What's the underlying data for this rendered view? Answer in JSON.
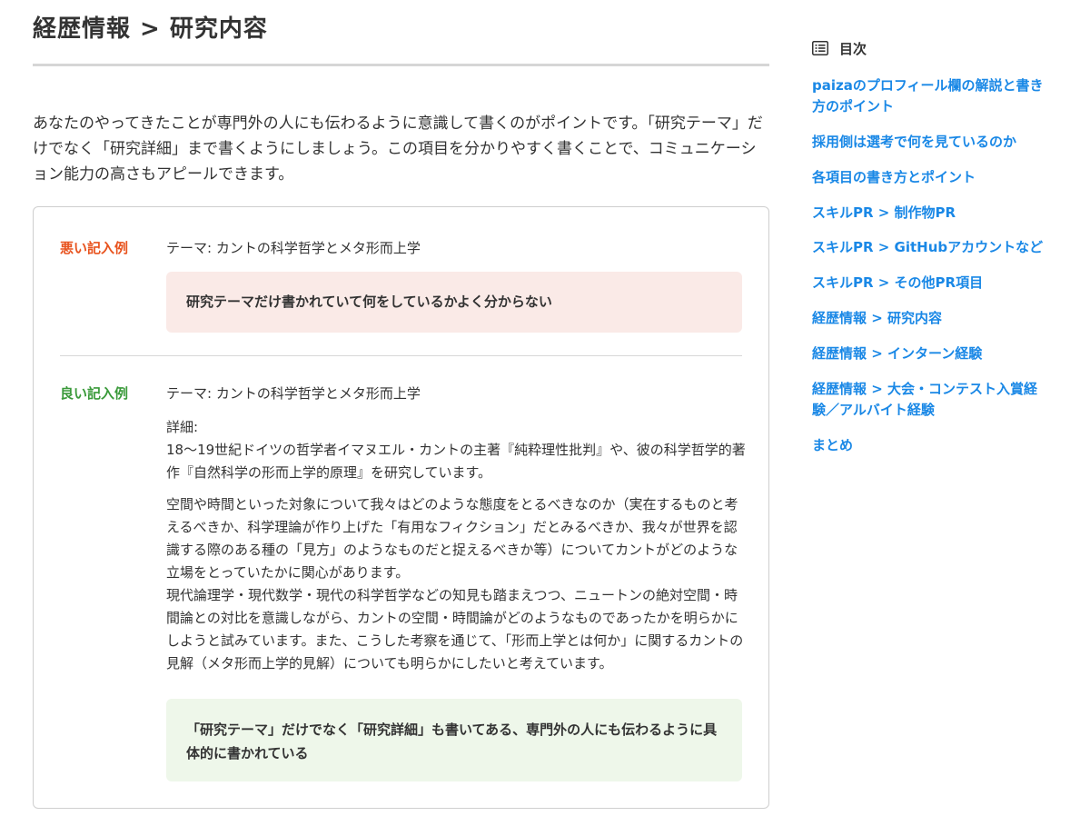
{
  "main": {
    "title": "経歴情報 > 研究内容",
    "intro": "あなたのやってきたことが専門外の人にも伝わるように意識して書くのがポイントです。「研究テーマ」だけでなく「研究詳細」まで書くようにしましょう。この項目を分かりやすく書くことで、コミュニケーション能力の高さもアピールできます。",
    "bad_example": {
      "label": "悪い記入例",
      "theme": "テーマ: カントの科学哲学とメタ形而上学",
      "comment": "研究テーマだけ書かれていて何をしているかよく分からない"
    },
    "good_example": {
      "label": "良い記入例",
      "theme": "テーマ: カントの科学哲学とメタ形而上学",
      "detail_heading": "詳細:",
      "detail_p1": "18〜19世紀ドイツの哲学者イマヌエル・カントの主著『純粋理性批判』や、彼の科学哲学的著作『自然科学の形而上学的原理』を研究しています。",
      "detail_p2": "空間や時間といった対象について我々はどのような態度をとるべきなのか（実在するものと考えるべきか、科学理論が作り上げた「有用なフィクション」だとみるべきか、我々が世界を認識する際のある種の「見方」のようなものだと捉えるべきか等）についてカントがどのような立場をとっていたかに関心があります。",
      "detail_p3": "現代論理学・現代数学・現代の科学哲学などの知見も踏まえつつ、ニュートンの絶対空間・時間論との対比を意識しながら、カントの空間・時間論がどのようなものであったかを明らかにしようと試みています。また、こうした考察を通じて、「形而上学とは何か」に関するカントの見解（メタ形而上学的見解）についても明らかにしたいと考えています。",
      "comment": "「研究テーマ」だけでなく「研究詳細」も書いてある、専門外の人にも伝わるように具体的に書かれている"
    }
  },
  "toc": {
    "title": "目次",
    "icon": "list-icon",
    "link_color": "#1a88e6",
    "items": [
      "paizaのプロフィール欄の解説と書き方のポイント",
      "採用側は選考で何を見ているのか",
      "各項目の書き方とポイント",
      "スキルPR > 制作物PR",
      "スキルPR > GitHubアカウントなど",
      "スキルPR > その他PR項目",
      "経歴情報 > 研究内容",
      "経歴情報 > インターン経験",
      "経歴情報 > 大会・コンテスト入賞経験／アルバイト経験",
      "まとめ"
    ]
  },
  "colors": {
    "bad_label": "#e8531e",
    "good_label": "#3a9a3a",
    "bad_callout_bg": "#faeae7",
    "good_callout_bg": "#eef7ea"
  }
}
